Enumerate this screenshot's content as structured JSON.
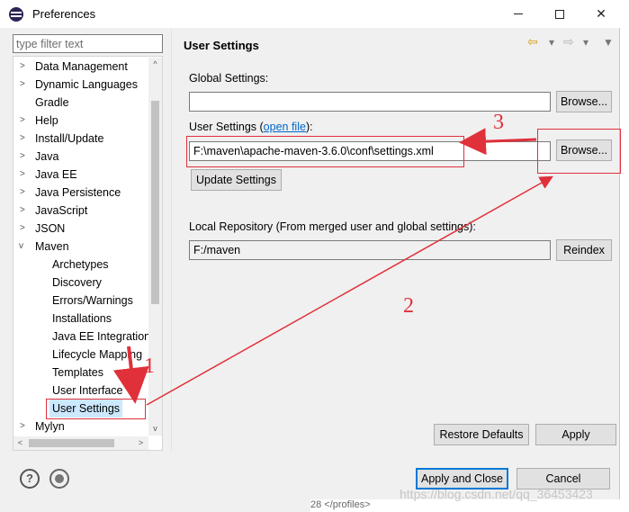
{
  "window": {
    "title": "Preferences",
    "minimize_icon": "minimize-icon",
    "maximize_icon": "maximize-icon",
    "close_glyph": "✕"
  },
  "filter": {
    "placeholder": "type filter text"
  },
  "tree": {
    "items": [
      {
        "label": "Data Management",
        "expandable": true
      },
      {
        "label": "Dynamic Languages",
        "expandable": true
      },
      {
        "label": "Gradle",
        "expandable": false
      },
      {
        "label": "Help",
        "expandable": true
      },
      {
        "label": "Install/Update",
        "expandable": true
      },
      {
        "label": "Java",
        "expandable": true
      },
      {
        "label": "Java EE",
        "expandable": true
      },
      {
        "label": "Java Persistence",
        "expandable": true
      },
      {
        "label": "JavaScript",
        "expandable": true
      },
      {
        "label": "JSON",
        "expandable": true
      },
      {
        "label": "Maven",
        "expandable": true,
        "expanded": true
      },
      {
        "label": "Archetypes"
      },
      {
        "label": "Discovery"
      },
      {
        "label": "Errors/Warnings"
      },
      {
        "label": "Installations"
      },
      {
        "label": "Java EE Integration"
      },
      {
        "label": "Lifecycle Mapping"
      },
      {
        "label": "Templates"
      },
      {
        "label": "User Interface"
      },
      {
        "label": "User Settings",
        "selected": true
      },
      {
        "label": "Mylyn",
        "expandable": true
      }
    ]
  },
  "page": {
    "title": "User Settings",
    "global_settings_label": "Global Settings:",
    "global_settings_value": "",
    "browse_label": "Browse...",
    "user_settings_label_prefix": "User Settings (",
    "open_file_link": "open file",
    "user_settings_label_suffix": "):",
    "user_settings_value": "F:\\maven\\apache-maven-3.6.0\\conf\\settings.xml",
    "update_settings_label": "Update Settings",
    "local_repo_label": "Local Repository (From merged user and global settings):",
    "local_repo_value": "F:/maven",
    "reindex_label": "Reindex",
    "restore_defaults_label": "Restore Defaults",
    "apply_label": "Apply"
  },
  "footer": {
    "apply_close_label": "Apply and Close",
    "cancel_label": "Cancel",
    "help_glyph": "?"
  },
  "annotations": {
    "step1": "1",
    "step2": "2",
    "step3": "3",
    "color": "#e0303a"
  },
  "background": {
    "watermark": "https://blog.csdn.net/qq_36453423",
    "bottom_text": "28    </profiles>"
  },
  "colors": {
    "selection": "#cce8ff",
    "link": "#0066cc",
    "default_button_border": "#0078d7"
  }
}
